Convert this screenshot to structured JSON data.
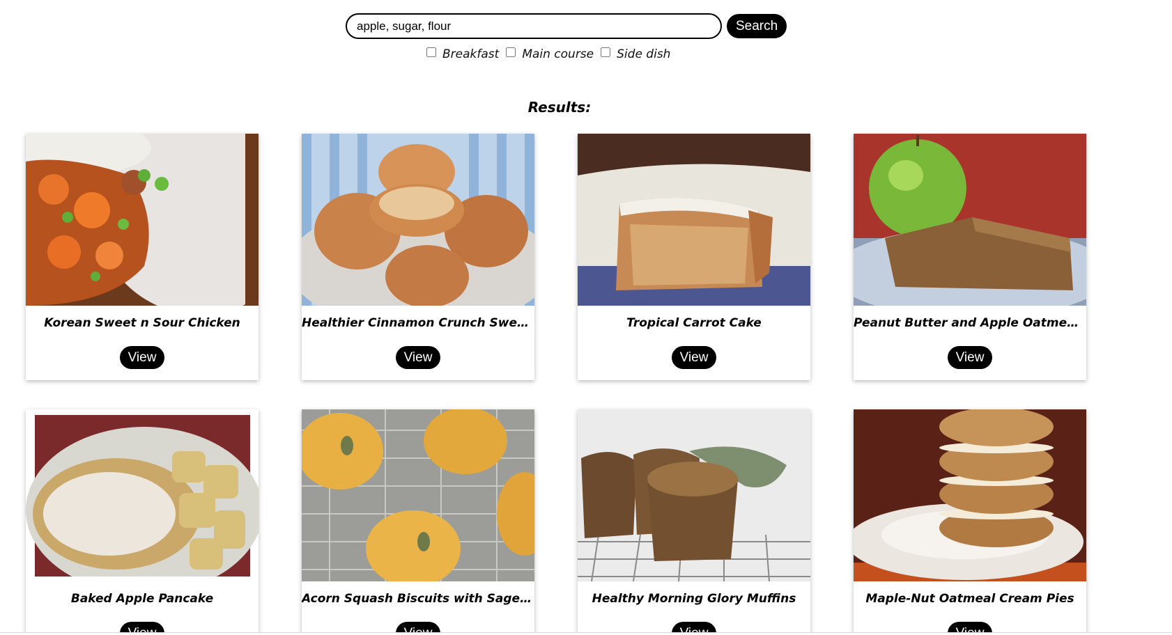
{
  "search": {
    "value": "apple, sugar, flour",
    "button_label": "Search"
  },
  "filters": [
    {
      "label": "Breakfast",
      "checked": false
    },
    {
      "label": "Main course",
      "checked": false
    },
    {
      "label": "Side dish",
      "checked": false
    }
  ],
  "results": {
    "heading": "Results:",
    "cards": [
      {
        "title": "Korean Sweet n Sour Chicken",
        "button_label": "View",
        "image": "sweet-sour-chicken-photo"
      },
      {
        "title": "Healthier Cinnamon Crunch Sweet Potato Muffins",
        "button_label": "View",
        "image": "cinnamon-muffins-photo"
      },
      {
        "title": "Tropical Carrot Cake",
        "button_label": "View",
        "image": "carrot-cake-photo"
      },
      {
        "title": "Peanut Butter and Apple Oatmeal Breakfast Bars",
        "button_label": "View",
        "image": "apple-oatmeal-bar-photo"
      },
      {
        "title": "Baked Apple Pancake",
        "button_label": "View",
        "image": "apple-pancake-photo"
      },
      {
        "title": "Acorn Squash Biscuits with Sage & Gruyere",
        "button_label": "View",
        "image": "squash-biscuits-photo"
      },
      {
        "title": "Healthy Morning Glory Muffins",
        "button_label": "View",
        "image": "morning-glory-muffins-photo"
      },
      {
        "title": "Maple-Nut Oatmeal Cream Pies",
        "button_label": "View",
        "image": "oatmeal-cream-pies-photo"
      }
    ]
  }
}
